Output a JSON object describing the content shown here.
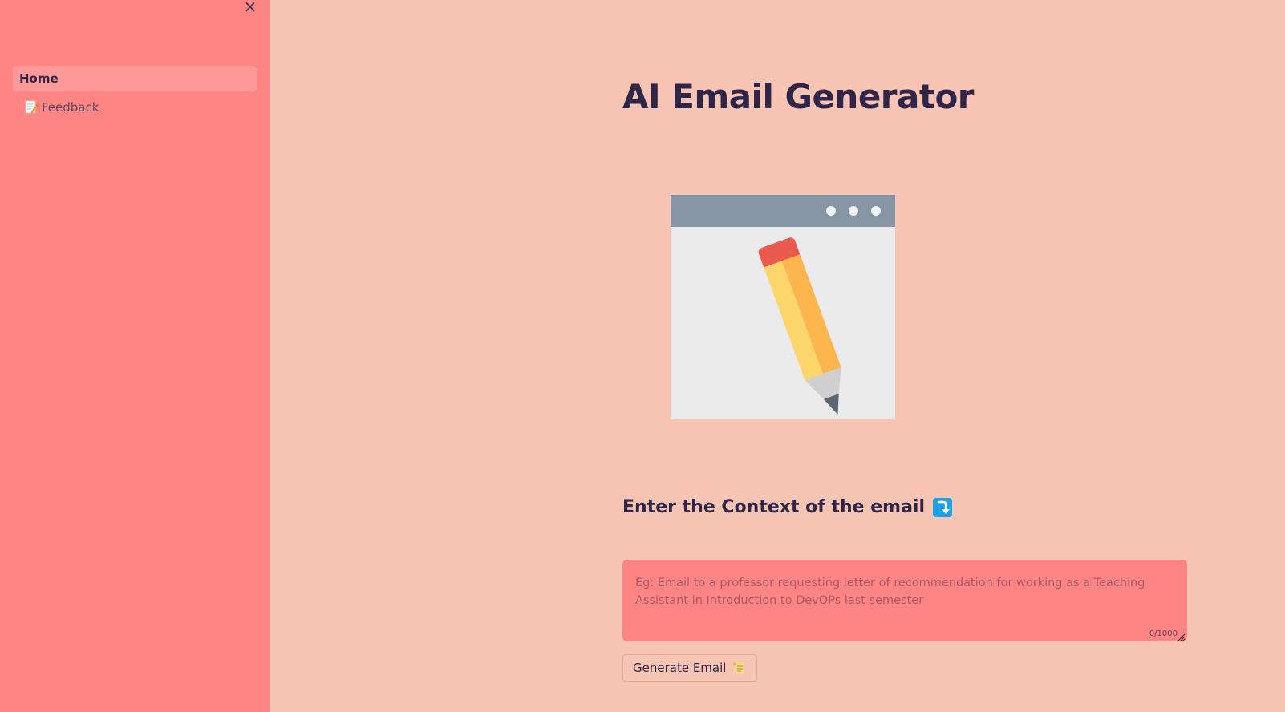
{
  "sidebar": {
    "close_label": "×",
    "items": [
      {
        "label": "Home",
        "icon": null,
        "active": true
      },
      {
        "label": "Feedback",
        "icon": "memo-icon",
        "active": false
      }
    ]
  },
  "main": {
    "title": "AI Email Generator",
    "hero_image": "pencil-window-illustration",
    "subheader": "Enter the Context of the email",
    "subheader_icon": "arrow-down-icon",
    "textarea": {
      "placeholder": "Eg: Email to a professor requesting letter of recommendation for working as a Teaching Assistant in Introduction to DevOPs last semester",
      "value": "",
      "char_count": "0/1000"
    },
    "generate_button": {
      "label": "Generate Email",
      "icon": "scroll-icon"
    }
  },
  "colors": {
    "background": "#f8c4b3",
    "sidebar": "#ff8585",
    "text": "#2e2548",
    "active_nav": "#ff9a9a"
  }
}
